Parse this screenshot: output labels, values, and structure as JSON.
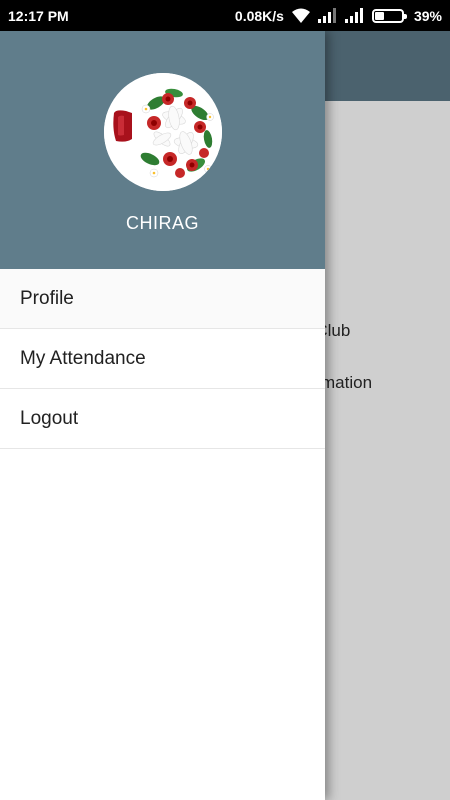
{
  "status_bar": {
    "time": "12:17 PM",
    "net_speed": "0.08K/s",
    "battery_percent": "39%",
    "battery_level": 0.39,
    "icons": [
      "wifi-icon",
      "signal-icon",
      "signal-icon",
      "battery-icon"
    ]
  },
  "background": {
    "text_line_1": "ricket Club",
    "text_line_2": "le information",
    "toolbar_color": "#4b626e"
  },
  "drawer": {
    "header_color": "#607d8b",
    "user_name": "CHIRAG",
    "avatar_icon": "flower-bouquet-avatar",
    "menu": [
      {
        "label": "Profile"
      },
      {
        "label": "My Attendance"
      },
      {
        "label": "Logout"
      }
    ]
  }
}
